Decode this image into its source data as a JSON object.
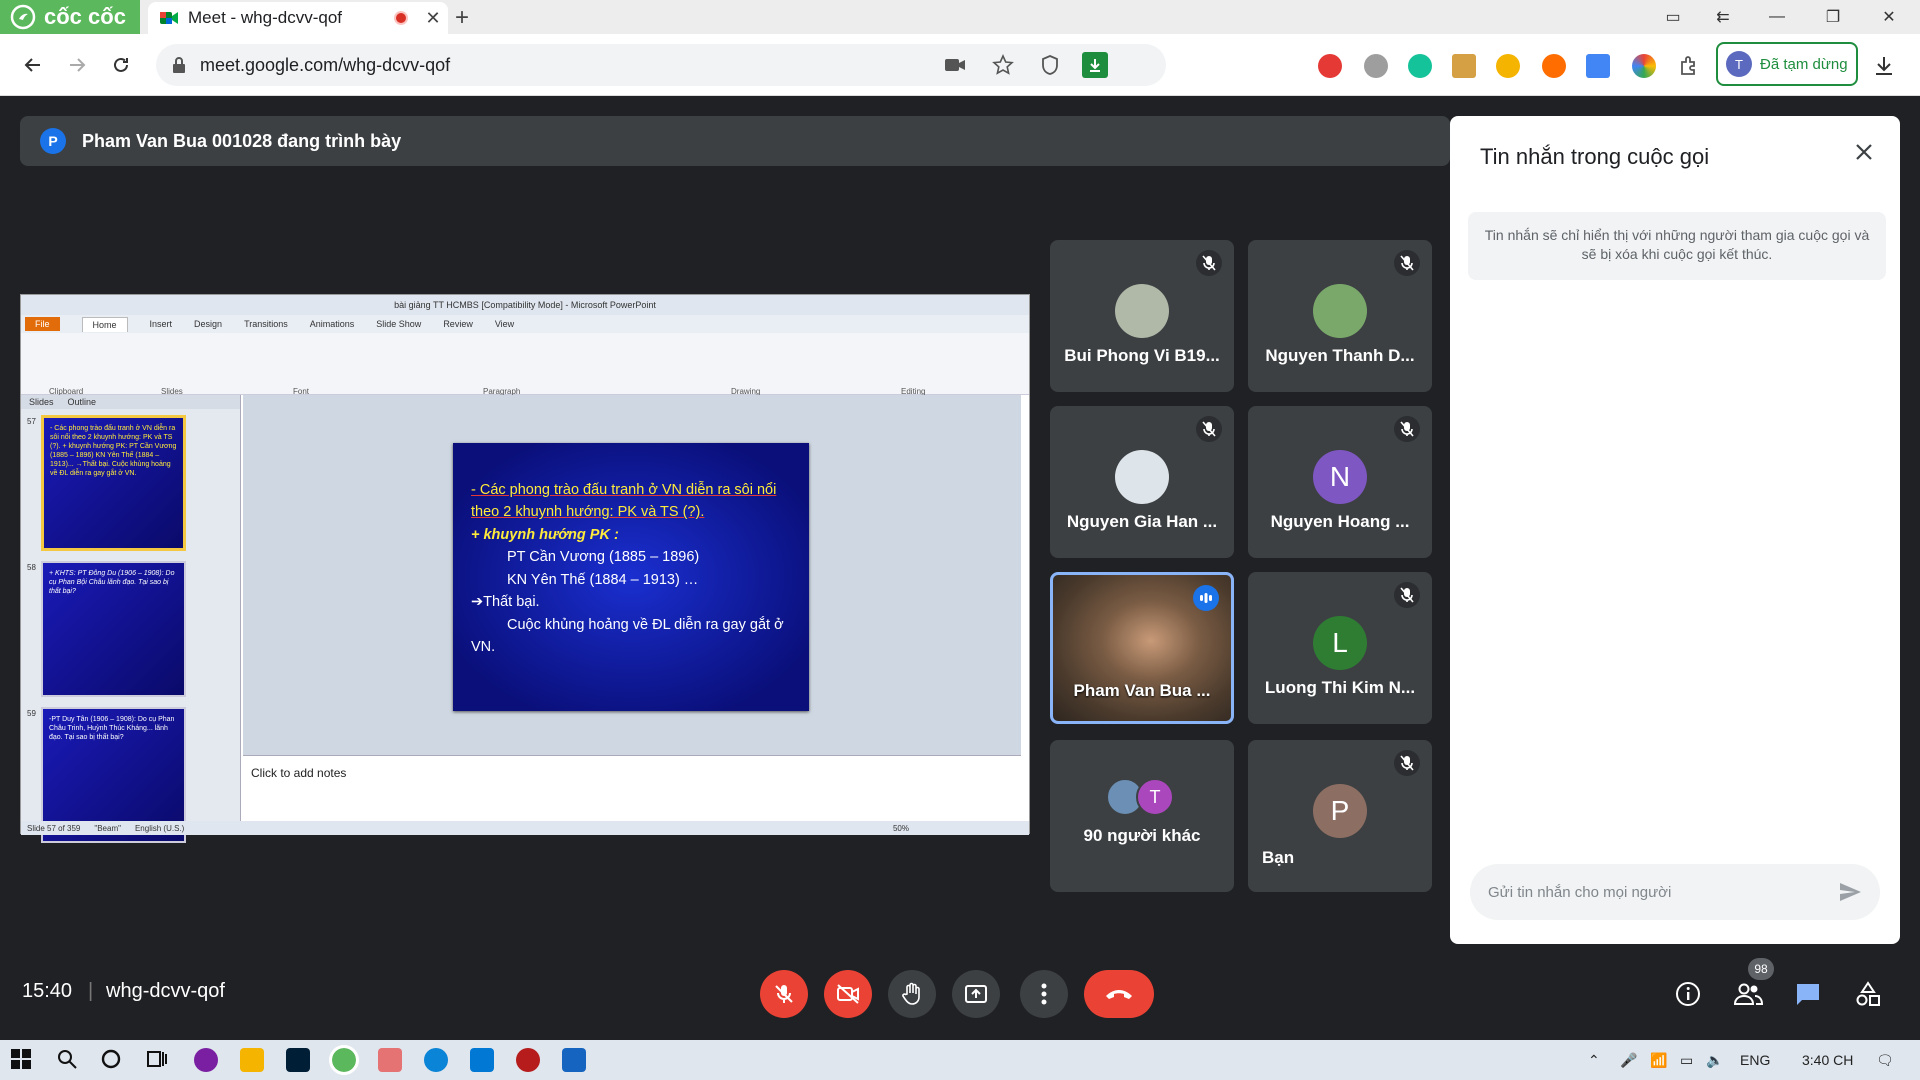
{
  "browser": {
    "brand": "cốc cốc",
    "tab_title": "Meet - whg-dcvv-qof",
    "url": "meet.google.com/whg-dcvv-qof",
    "profile_label": "Đã tạm dừng",
    "profile_initial": "T"
  },
  "presenter_bar": {
    "initial": "P",
    "text": "Pham Van Bua 001028 đang trình bày"
  },
  "shared_screen": {
    "window_title": "bài giảng TT HCMBS [Compatibility Mode] - Microsoft PowerPoint",
    "ribbon_tabs": [
      "File",
      "Home",
      "Insert",
      "Design",
      "Transitions",
      "Animations",
      "Slide Show",
      "Review",
      "View"
    ],
    "ribbon_groups": [
      "Clipboard",
      "Slides",
      "Font",
      "Paragraph",
      "Drawing",
      "Editing"
    ],
    "pane_tabs": [
      "Slides",
      "Outline"
    ],
    "thumbnails": [
      {
        "num": "57",
        "text": "- Các phong trào đấu tranh ở VN diễn ra sôi nổi theo 2 khuynh hướng: PK và TS (?). + khuynh hướng PK: PT Cần Vương (1885 – 1896) KN Yên Thế (1884 – 1913)... →Thất bại. Cuộc khủng hoảng về ĐL diễn ra gay gắt ở VN."
      },
      {
        "num": "58",
        "text": "+ KHTS: PT Đông Du (1906 – 1908): Do cụ Phan Bội Châu lãnh đạo. Tại sao bị thất bại?"
      },
      {
        "num": "59",
        "text": "-PT Duy Tân (1906 – 1908): Do cụ Phan Châu Trinh, Huỳnh Thúc Kháng... lãnh đạo. Tại sao bị thất bại?"
      }
    ],
    "slide_lines": [
      "- Các phong trào đấu tranh ở VN diễn ra sôi nổi theo 2 khuynh hướng: PK và TS (?).",
      "+ khuynh hướng PK :",
      "PT Cần Vương (1885 – 1896)",
      "KN Yên Thế (1884 – 1913) …",
      "➔Thất bại.",
      "Cuộc khủng hoảng về ĐL diễn ra gay gắt ở VN."
    ],
    "notes_placeholder": "Click to add notes",
    "status_slide": "Slide 57 of 359",
    "status_theme": "\"Beam\"",
    "status_lang": "English (U.S.)",
    "zoom": "50%"
  },
  "participants": [
    {
      "name": "Bui Phong Vi B19...",
      "muted": true,
      "avatar": "photo",
      "color": "#b0b8a8"
    },
    {
      "name": "Nguyen Thanh D...",
      "muted": true,
      "avatar": "photo",
      "color": "#7aa86a"
    },
    {
      "name": "Nguyen Gia Han ...",
      "muted": true,
      "avatar": "photo",
      "color": "#dde4ea"
    },
    {
      "name": "Nguyen Hoang ...",
      "muted": true,
      "avatar": "N",
      "color": "#7e57c2"
    },
    {
      "name": "Pham Van Bua ...",
      "muted": false,
      "avatar": "video",
      "color": "#5a4a3a"
    },
    {
      "name": "Luong Thi Kim N...",
      "muted": true,
      "avatar": "L",
      "color": "#2e7d32"
    },
    {
      "name": "90 người khác",
      "muted": false,
      "avatar": "group",
      "color": "#3c4043"
    },
    {
      "name": "Bạn",
      "muted": true,
      "avatar": "P",
      "color": "#8d6e63"
    }
  ],
  "group_avatar_initial": "T",
  "chat": {
    "title": "Tin nhắn trong cuộc gọi",
    "info": "Tin nhắn sẽ chỉ hiển thị với những người tham gia cuộc gọi và sẽ bị xóa khi cuộc gọi kết thúc.",
    "input_placeholder": "Gửi tin nhắn cho mọi người"
  },
  "bottom_bar": {
    "time": "15:40",
    "separator": "|",
    "meeting_code": "whg-dcvv-qof",
    "participant_count": "98"
  },
  "taskbar": {
    "lang": "ENG",
    "time": "3:40 CH"
  },
  "colors": {
    "accent_red": "#ea4335",
    "meet_blue": "#8ab4f8",
    "brand_green": "#5cb85c"
  }
}
